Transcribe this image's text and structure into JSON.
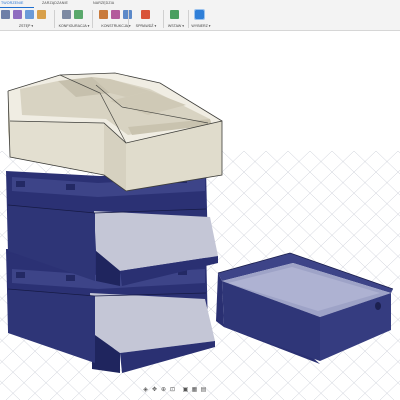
{
  "ribbon": {
    "tabs": [
      {
        "label": "TWORZENIE"
      },
      {
        "label": "ZARZĄDZANIE"
      },
      {
        "label": "NARZĘDZIA"
      }
    ],
    "groups": [
      {
        "label": "ZSTĘP ▾"
      },
      {
        "label": "KONFIGURACJA ▾"
      },
      {
        "label": "KONSTRUKCJA ▾"
      },
      {
        "label": "SPRAWDŹ ▾"
      },
      {
        "label": "WSTAW ▾"
      },
      {
        "label": "WYBIERZ ▾"
      }
    ]
  },
  "colors": {
    "navy": "#2e3577",
    "navy_light": "#4a52a0",
    "beige": "#e6e2d4",
    "grid": "#c9ccd6",
    "accent": "#1e6fd0"
  },
  "viewport": {
    "model": "desk organizer — beige top tray, two navy drawer tiers, separate navy tray"
  },
  "navbar": {
    "icons": [
      "orbit-icon",
      "pan-icon",
      "zoom-icon",
      "fit-icon",
      "display-icon",
      "grid-icon",
      "view-icon"
    ]
  }
}
